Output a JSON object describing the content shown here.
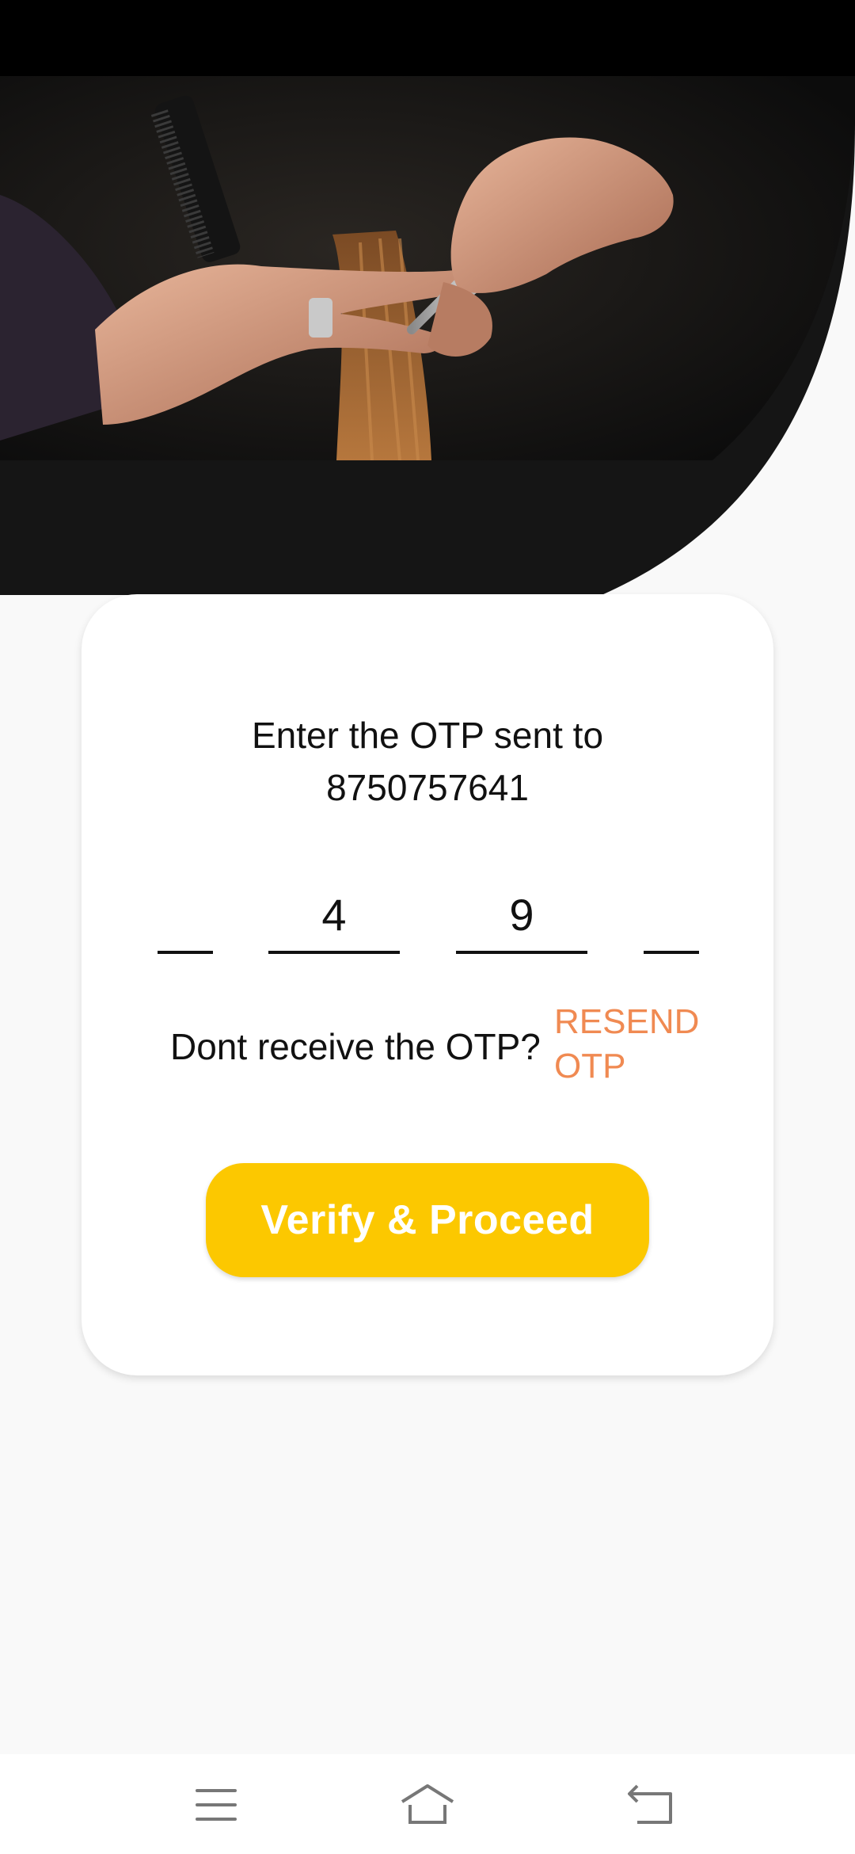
{
  "otp_card": {
    "title": "Enter the OTP sent to",
    "phone": "8750757641",
    "digits": [
      "",
      "4",
      "9",
      ""
    ],
    "resend_question": "Dont receive the OTP?",
    "resend_label": "RESEND OTP",
    "verify_label": "Verify & Proceed"
  },
  "colors": {
    "accent": "#fcc800",
    "resend": "#f08a52",
    "hero_dark": "#151515"
  },
  "icons": {
    "hero": "barber-haircut-photo",
    "nav_menu": "menu-icon",
    "nav_home": "home-icon",
    "nav_back": "back-icon"
  }
}
